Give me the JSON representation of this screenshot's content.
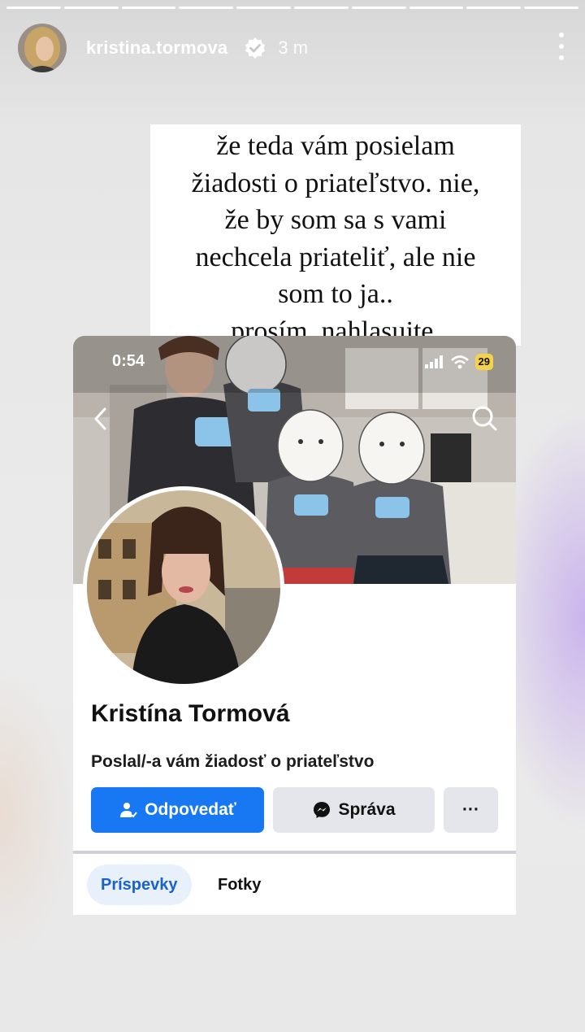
{
  "story": {
    "segment_count": 10,
    "username": "kristina.tormova",
    "time": "3 m",
    "caption_lines": [
      "že teda vám posielam",
      "žiadosti o priateľstvo. nie,",
      "že by som sa s vami",
      "nechcela priateliť, ale nie",
      "som to ja..",
      "prosím, nahlasujte."
    ]
  },
  "screenshot": {
    "status_time": "0:54",
    "battery": "29",
    "profile_name": "Kristína Tormová",
    "request_text": "Poslal/-a vám žiadosť o priateľstvo",
    "buttons": {
      "respond": "Odpovedať",
      "message": "Správa",
      "more": "···"
    },
    "tabs": {
      "posts": "Príspevky",
      "photos": "Fotky"
    }
  },
  "colors": {
    "facebook_blue": "#1877f2",
    "secondary_button": "#e4e6eb",
    "battery": "#f4d24a"
  }
}
